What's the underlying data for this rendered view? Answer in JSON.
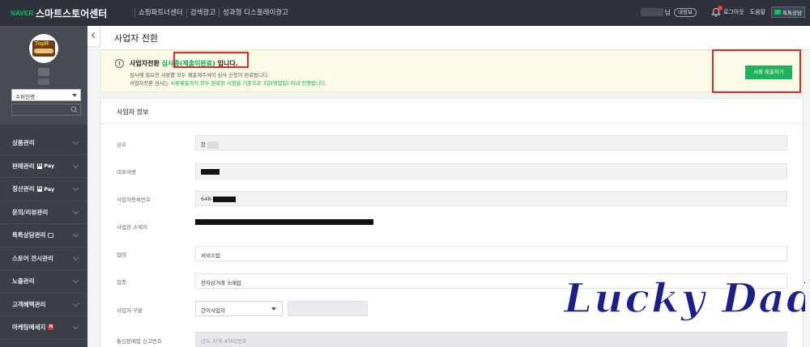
{
  "topbar": {
    "brand": "NAVER",
    "title": "스마트스토어센터",
    "nav": [
      "쇼핑파트너센터",
      "검색광고",
      "성과형 디스플레이광고"
    ],
    "user_suffix": "님",
    "my_badge": "내정보",
    "logout": "로그아웃",
    "help": "도움말",
    "talk": "톡톡상담"
  },
  "sidebar": {
    "avatar_text": "TopR",
    "status": "수퍼인명",
    "menu": [
      {
        "label": "상품관리"
      },
      {
        "label": "판매관리",
        "badge": "Pay"
      },
      {
        "label": "정산관리",
        "badge": "Pay"
      },
      {
        "label": "문의/리뷰관리"
      },
      {
        "label": "톡톡상담관리"
      },
      {
        "label": "스토어 전시관리"
      },
      {
        "label": "노출관리"
      },
      {
        "label": "고객혜택관리"
      },
      {
        "label": "마케팅메세지"
      }
    ]
  },
  "page": {
    "title": "사업자 전환"
  },
  "notice": {
    "title_prefix": "사업자전환",
    "title_status": "심사중(제출미완료)",
    "title_suffix": "입니다.",
    "line1": "심사에 필요한 서류를 모두 제출해주셔야 심사 신청이 완료됩니다.",
    "line2_prefix": "사업자전환 심사는",
    "line2_green": "서류제출까지 모두 완료된 시점을 기준으로 3일(영업일) 이내 진행됩니다.",
    "button": "서류 제출하기"
  },
  "form": {
    "section_title": "사업자 정보",
    "fields": [
      {
        "label": "상호",
        "value": "한"
      },
      {
        "label": "대표자명",
        "value": ""
      },
      {
        "label": "사업자등록번호",
        "value": "648-"
      },
      {
        "label": "사업장 소재지",
        "value": ""
      },
      {
        "label": "업태",
        "value": "서비스업"
      },
      {
        "label": "업종",
        "value": "전자상거래 소매업"
      },
      {
        "label": "사업자 구분",
        "value": "간이사업자"
      },
      {
        "label": "통신판매업 신고번호",
        "placeholder": "년도-지역-4자리번호"
      }
    ]
  },
  "watermark": {
    "text": "Lucky Daddy",
    "colors": [
      "#1a1f8c",
      "#d9382a",
      "#ffffff"
    ]
  },
  "colors": {
    "accent_green": "#03c75a",
    "button_green": "#1fb25a",
    "highlight_red": "#e0252b",
    "topbar": "#2f323a",
    "sidebar": "#3b3f47"
  }
}
